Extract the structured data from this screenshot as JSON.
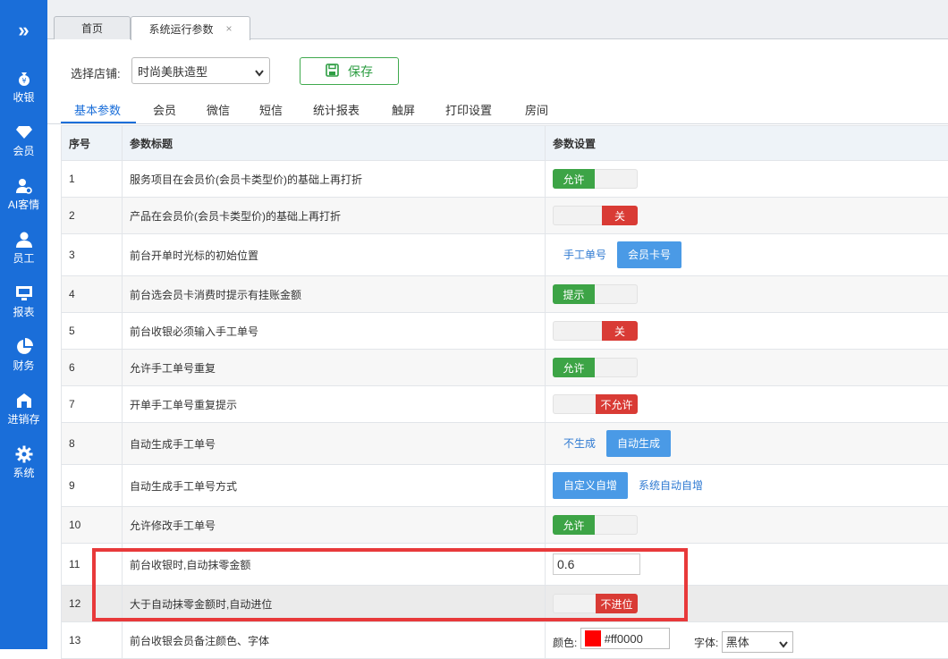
{
  "sidebar": {
    "toggle_glyph": "»",
    "items": [
      {
        "label": "收银",
        "icon": "cashier-icon"
      },
      {
        "label": "会员",
        "icon": "diamond-icon"
      },
      {
        "label": "AI客情",
        "icon": "ai-customer-icon"
      },
      {
        "label": "员工",
        "icon": "employee-icon"
      },
      {
        "label": "报表",
        "icon": "report-icon"
      },
      {
        "label": "财务",
        "icon": "pie-chart-icon"
      },
      {
        "label": "进销存",
        "icon": "warehouse-icon"
      },
      {
        "label": "系统",
        "icon": "gear-icon"
      }
    ]
  },
  "tabs": [
    {
      "label": "首页"
    },
    {
      "label": "系统运行参数",
      "close": "×"
    }
  ],
  "toolbar": {
    "store_label": "选择店铺:",
    "store_value": "时尚美肤造型",
    "save_label": "保存"
  },
  "subtabs": [
    {
      "label": "基本参数",
      "active": true
    },
    {
      "label": "会员"
    },
    {
      "label": "微信"
    },
    {
      "label": "短信"
    },
    {
      "label": "统计报表"
    },
    {
      "label": "触屏"
    },
    {
      "label": "打印设置"
    },
    {
      "label": "房间"
    }
  ],
  "table": {
    "headers": [
      "序号",
      "参数标题",
      "参数设置"
    ],
    "rows": [
      {
        "no": "1",
        "title": "服务项目在会员价(会员卡类型价)的基础上再打折",
        "setting": {
          "kind": "toggle_on",
          "text": "允许"
        }
      },
      {
        "no": "2",
        "title": "产品在会员价(会员卡类型价)的基础上再打折",
        "setting": {
          "kind": "toggle_off",
          "text": "关"
        }
      },
      {
        "no": "3",
        "title": "前台开单时光标的初始位置",
        "setting": {
          "kind": "segment",
          "options": [
            "手工单号",
            "会员卡号"
          ],
          "selected": 1
        }
      },
      {
        "no": "4",
        "title": "前台选会员卡消费时提示有挂账金额",
        "setting": {
          "kind": "toggle_on",
          "text": "提示"
        }
      },
      {
        "no": "5",
        "title": "前台收银必须输入手工单号",
        "setting": {
          "kind": "toggle_off",
          "text": "关"
        }
      },
      {
        "no": "6",
        "title": "允许手工单号重复",
        "setting": {
          "kind": "toggle_on",
          "text": "允许"
        }
      },
      {
        "no": "7",
        "title": "开单手工单号重复提示",
        "setting": {
          "kind": "toggle_off_wide",
          "text": "不允许"
        }
      },
      {
        "no": "8",
        "title": "自动生成手工单号",
        "setting": {
          "kind": "segment",
          "options": [
            "不生成",
            "自动生成"
          ],
          "selected": 1
        }
      },
      {
        "no": "9",
        "title": "自动生成手工单号方式",
        "setting": {
          "kind": "segment",
          "options": [
            "自定义自增",
            "系统自动自增"
          ],
          "selected": 0
        }
      },
      {
        "no": "10",
        "title": "允许修改手工单号",
        "setting": {
          "kind": "toggle_on",
          "text": "允许"
        }
      },
      {
        "no": "11",
        "title": "前台收银时,自动抹零金额",
        "setting": {
          "kind": "input",
          "value": "0.6"
        }
      },
      {
        "no": "12",
        "title": "大于自动抹零金额时,自动进位",
        "setting": {
          "kind": "toggle_off_wide",
          "text": "不进位"
        }
      },
      {
        "no": "13",
        "title": "前台收银会员备注颜色、字体",
        "setting": {
          "kind": "color_font",
          "color_label": "颜色:",
          "color_value": "#ff0000",
          "font_label": "字体:",
          "font_value": "黑体"
        }
      }
    ]
  },
  "annotation_color": "#e8393a"
}
